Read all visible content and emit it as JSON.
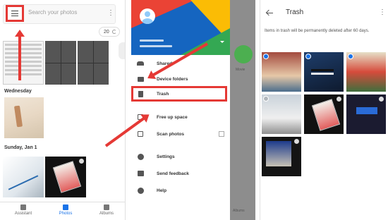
{
  "photos_app": {
    "search_placeholder": "Search your photos",
    "photo_count": "20",
    "sections": [
      "Wednesday",
      "Sunday, Jan 1"
    ],
    "bottom_nav": [
      {
        "label": "Assistant",
        "icon": "assistant-icon"
      },
      {
        "label": "Photos",
        "icon": "photos-icon"
      },
      {
        "label": "Albums",
        "icon": "albums-icon"
      }
    ]
  },
  "drawer": {
    "items": [
      {
        "label": "Shared",
        "icon": "people-icon"
      },
      {
        "label": "Device folders",
        "icon": "folder-icon"
      },
      {
        "label": "Trash",
        "icon": "trash-icon"
      },
      {
        "label": "Free up space",
        "icon": "free-space-icon"
      },
      {
        "label": "Scan photos",
        "icon": "scan-icon"
      },
      {
        "label": "Settings",
        "icon": "gear-icon"
      },
      {
        "label": "Send feedback",
        "icon": "feedback-icon"
      },
      {
        "label": "Help",
        "icon": "help-icon"
      }
    ],
    "overlay_labels": [
      "Movie",
      "Albums"
    ]
  },
  "trash": {
    "title": "Trash",
    "notice": "Items in trash will be permanently deleted after 60 days."
  },
  "colors": {
    "accent": "#1a73e8",
    "highlight": "#e53935"
  }
}
